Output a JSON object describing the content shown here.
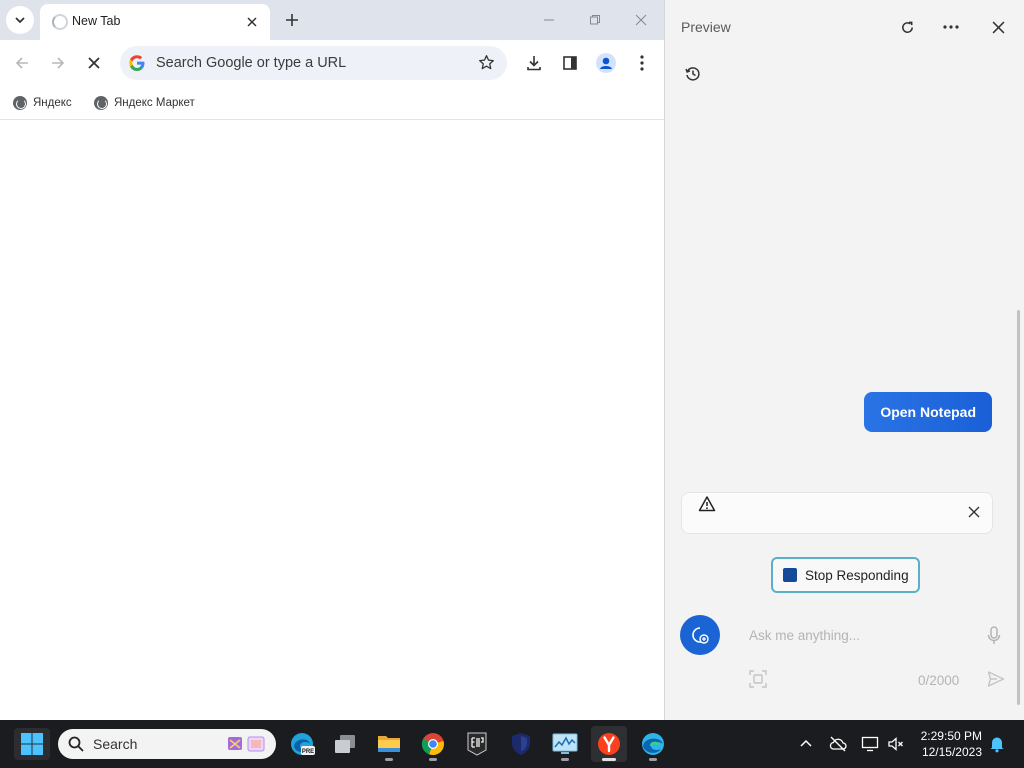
{
  "browser": {
    "tab": {
      "title": "New Tab"
    },
    "omnibox": {
      "placeholder": "Search Google or type a URL"
    },
    "bookmarks": [
      {
        "label": "Яндекс"
      },
      {
        "label": "Яндекс Маркет"
      }
    ]
  },
  "copilot": {
    "title": "Preview",
    "user_message": "Open Notepad",
    "stop_label": "Stop Responding",
    "input_placeholder": "Ask me anything...",
    "char_counter": "0/2000"
  },
  "taskbar": {
    "search_placeholder": "Search",
    "time": "2:29:50 PM",
    "date": "12/15/2023",
    "apps": [
      "edge-beta",
      "task-view",
      "file-explorer",
      "chrome",
      "epic-games",
      "security-app",
      "resource-monitor",
      "yandex-browser",
      "edge"
    ]
  },
  "colors": {
    "accent": "#1a64d4",
    "stop_border": "#5bb0c9",
    "tabstrip": "#dfe3eb",
    "taskbar": "#1b1c1f"
  }
}
